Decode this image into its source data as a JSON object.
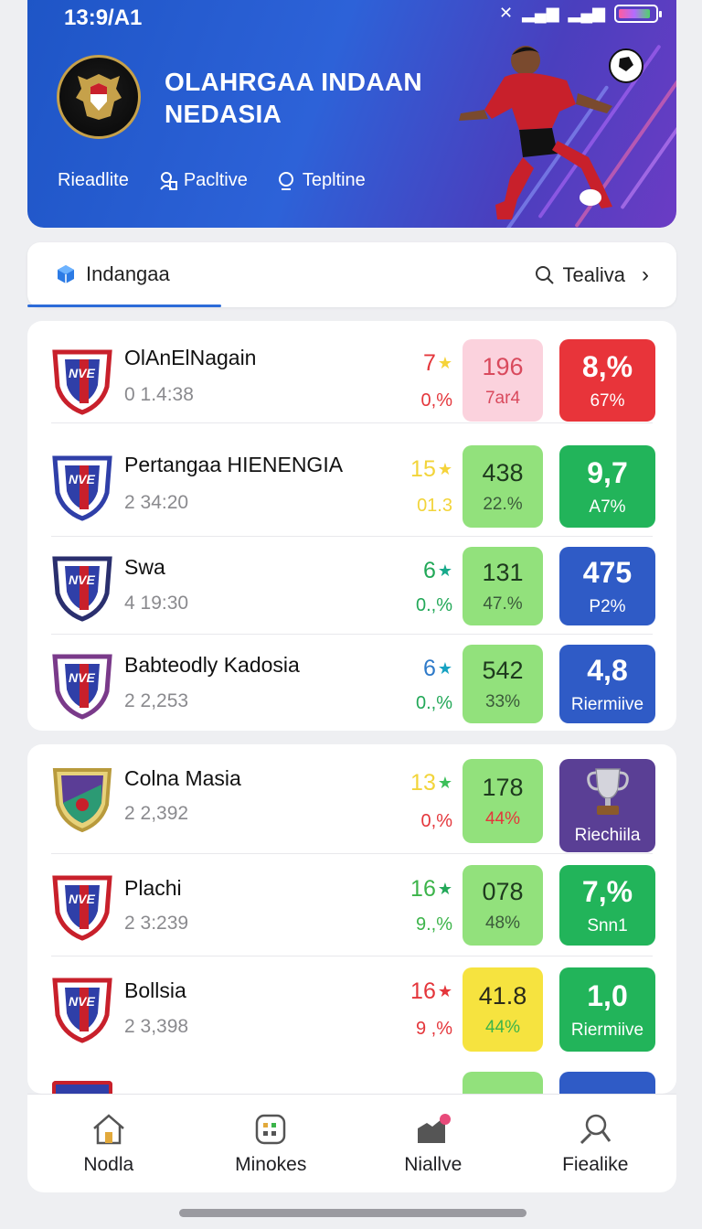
{
  "status": {
    "time": "13:9/A1"
  },
  "header": {
    "title_line1": "OLAHRGAA INDAAN",
    "title_line2": "NEDASIA",
    "nav": [
      {
        "label": "Rieadlite",
        "icon": "none"
      },
      {
        "label": "Pacltive",
        "icon": "person-icon"
      },
      {
        "label": "Tepltine",
        "icon": "search-icon"
      }
    ]
  },
  "tabs": {
    "left_label": "Indangaa",
    "right_label": "Tealiva"
  },
  "colors": {
    "red": "#e8343a",
    "green": "#22b45a",
    "blue": "#2f5bc6",
    "lightgreen": "#92e17c",
    "pink": "#fbd2dd",
    "yellow": "#f6e33f",
    "purple": "#5a3f95"
  },
  "rows": [
    {
      "name": "OlAnElNagain",
      "sub": "0 1.4:38",
      "rank": "7",
      "pct": "0,%",
      "mid_value": "196",
      "mid_sub": "7ar4",
      "right_value": "8,%",
      "right_sub": "67%"
    },
    {
      "name": "Pertangaa HIENENGIA",
      "sub": "2 34:20",
      "rank": "15",
      "pct": "01.3",
      "mid_value": "438",
      "mid_sub": "22.%",
      "right_value": "9,7",
      "right_sub": "A7%"
    },
    {
      "name": "Swa",
      "sub": "4 19:30",
      "rank": "6",
      "pct": "0.,%",
      "mid_value": "131",
      "mid_sub": "47.%",
      "right_value": "475",
      "right_sub": "P2%"
    },
    {
      "name": "Babteodly Kadosia",
      "sub": "2 2,253",
      "rank": "6",
      "pct": "0.,%",
      "mid_value": "542",
      "mid_sub": "33%",
      "right_value": "4,8",
      "right_sub": "Riermiive"
    },
    {
      "name": "Colna Masia",
      "sub": "2 2,392",
      "rank": "13",
      "pct": "0,%",
      "mid_value": "178",
      "mid_sub": "44%",
      "right_value": "",
      "right_sub": "Riechiila"
    },
    {
      "name": "Plachi",
      "sub": "2 3:239",
      "rank": "16",
      "pct": "9.,%",
      "mid_value": "078",
      "mid_sub": "48%",
      "right_value": "7,%",
      "right_sub": "Snn1"
    },
    {
      "name": "Bollsia",
      "sub": "2 3,398",
      "rank": "16",
      "pct": "9 ,%",
      "mid_value": "41.8",
      "mid_sub": "44%",
      "right_value": "1,0",
      "right_sub": "Riermiive"
    }
  ],
  "bottom_nav": [
    {
      "label": "Nodla",
      "icon": "home-icon"
    },
    {
      "label": "Minokes",
      "icon": "grid-icon"
    },
    {
      "label": "Niallve",
      "icon": "notification-icon"
    },
    {
      "label": "Fiealike",
      "icon": "search-icon"
    }
  ]
}
